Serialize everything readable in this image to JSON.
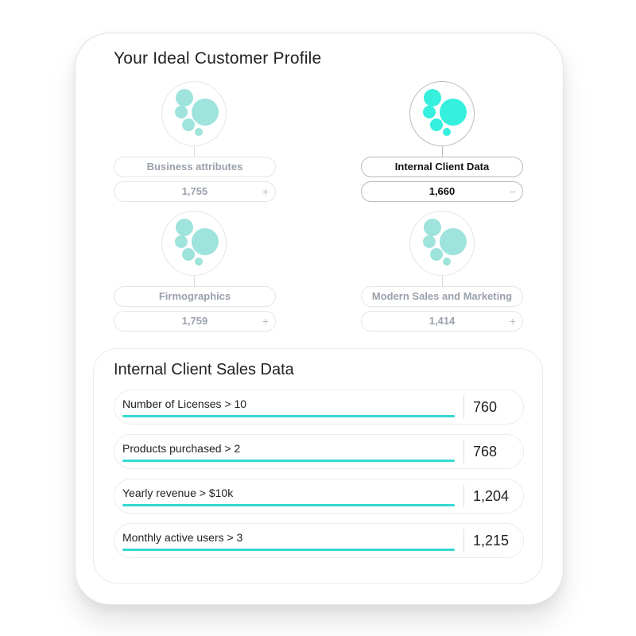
{
  "title": "Your Ideal Customer Profile",
  "colors": {
    "active_bubble": "#35f0dd",
    "inactive_bubble": "#9ee3dc",
    "bar": "#35d9d0"
  },
  "segments": [
    {
      "label": "Business attributes",
      "count": "1,755",
      "toggle": "+",
      "active": false
    },
    {
      "label": "Internal Client Data",
      "count": "1,660",
      "toggle": "−",
      "active": true
    },
    {
      "label": "Firmographics",
      "count": "1,759",
      "toggle": "+",
      "active": false
    },
    {
      "label": "Modern Sales and Marketing",
      "count": "1,414",
      "toggle": "+",
      "active": false
    }
  ],
  "panel": {
    "title": "Internal Client Sales Data",
    "rows": [
      {
        "label": "Number of Licenses > 10",
        "value": "760",
        "fill": 1.0
      },
      {
        "label": "Products purchased > 2",
        "value": "768",
        "fill": 1.0
      },
      {
        "label": "Yearly revenue > $10k",
        "value": "1,204",
        "fill": 1.0
      },
      {
        "label": "Monthly active users > 3",
        "value": "1,215",
        "fill": 1.0
      }
    ]
  }
}
